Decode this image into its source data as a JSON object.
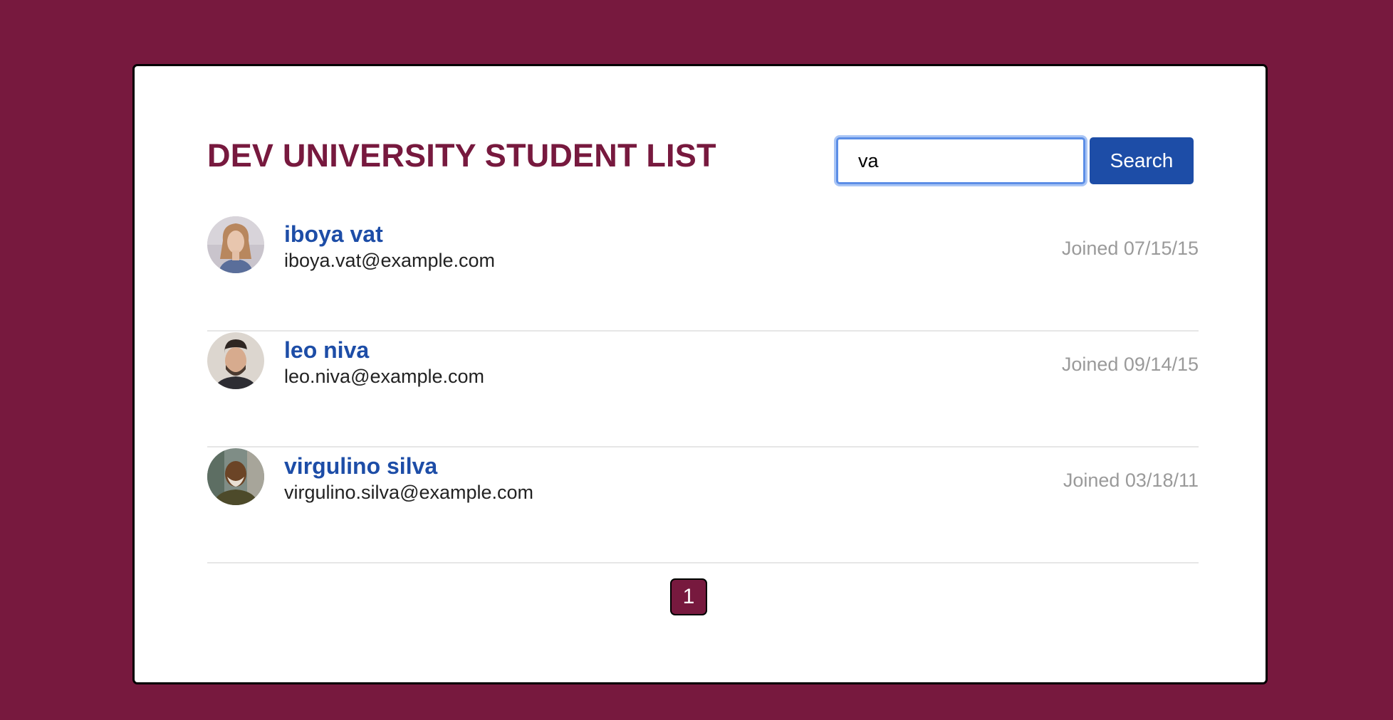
{
  "header": {
    "title": "DEV UNIVERSITY STUDENT LIST"
  },
  "search": {
    "value": "va",
    "button_label": "Search"
  },
  "students": [
    {
      "name": "iboya vat",
      "email": "iboya.vat@example.com",
      "joined": "Joined 07/15/15"
    },
    {
      "name": "leo niva",
      "email": "leo.niva@example.com",
      "joined": "Joined 09/14/15"
    },
    {
      "name": "virgulino silva",
      "email": "virgulino.silva@example.com",
      "joined": "Joined 03/18/11"
    }
  ],
  "pagination": {
    "pages": [
      "1"
    ],
    "active": "1"
  },
  "colors": {
    "background": "#77193e",
    "card": "#ffffff",
    "title": "#77193e",
    "name_link": "#1d4da7",
    "button": "#1d4da7",
    "focus_ring": "#5c8ee6",
    "joined_text": "#9a9a9a",
    "divider": "#e6e6e6"
  }
}
